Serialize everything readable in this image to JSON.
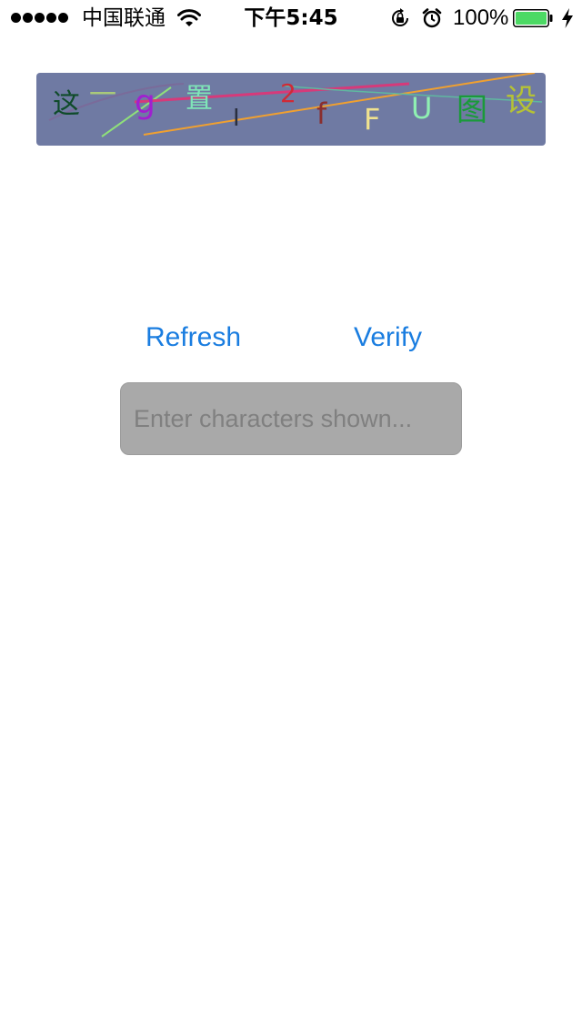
{
  "status_bar": {
    "carrier": "中国联通",
    "time": "下午5:45",
    "battery": "100%",
    "battery_level": 1.0,
    "signal_bars": 5,
    "icons": [
      "signal-dots",
      "wifi-icon",
      "rotation-lock-icon",
      "alarm-icon",
      "battery-icon",
      "charging-bolt-icon"
    ]
  },
  "captcha": {
    "background": "#6f7aa3",
    "characters": [
      {
        "char": "这",
        "color": "#0f4b2a"
      },
      {
        "char": "一",
        "color": "#a9c97a"
      },
      {
        "char": "g",
        "color": "#a020d0"
      },
      {
        "char": "置",
        "color": "#7fe6b8"
      },
      {
        "char": "I",
        "color": "#2a2f3f"
      },
      {
        "char": "2",
        "color": "#d02a36"
      },
      {
        "char": "f",
        "color": "#8a2e2e"
      },
      {
        "char": "F",
        "color": "#f0e28e"
      },
      {
        "char": "U",
        "color": "#8ff0b2"
      },
      {
        "char": "图",
        "color": "#1a9a3a"
      },
      {
        "char": "设",
        "color": "#b5c235"
      }
    ]
  },
  "actions": {
    "refresh_label": "Refresh",
    "verify_label": "Verify"
  },
  "input": {
    "placeholder": "Enter characters shown...",
    "value": ""
  },
  "colors": {
    "accent": "#1a7de0",
    "input_bg": "#a9a9a9",
    "battery_green": "#4cd964"
  }
}
